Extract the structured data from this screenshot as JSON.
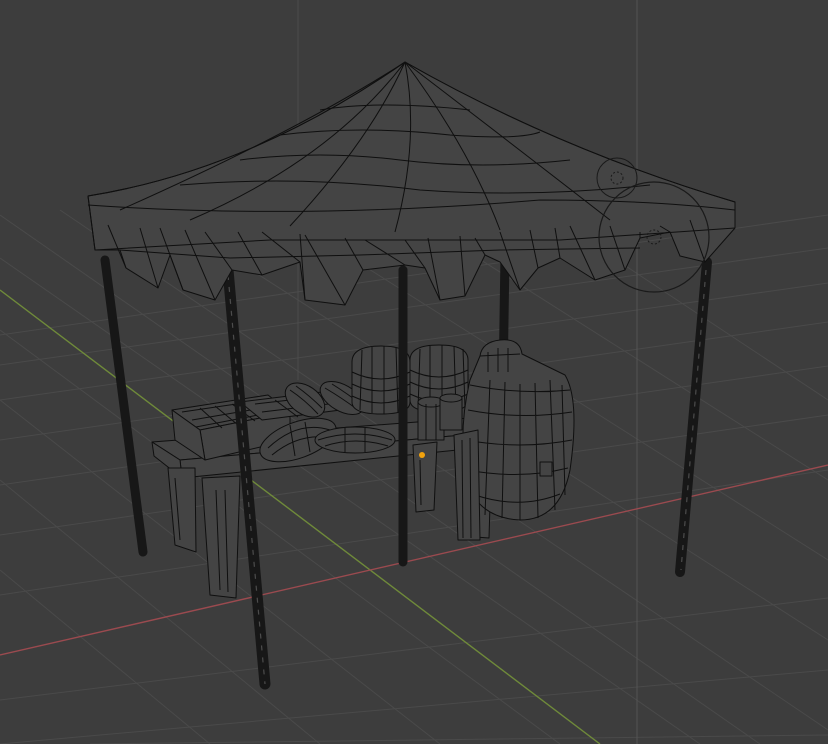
{
  "viewport": {
    "mode": "wireframe",
    "background": "#3d3d3d",
    "grid_color": "#4a4a4a",
    "x_axis_color": "#9b4a4f",
    "y_axis_color": "#6f8a3a",
    "wire_color": "#0f0f0f",
    "selected_origin_color": "#f2a20d"
  },
  "scene": {
    "objects": [
      "canopy",
      "support-poles",
      "market-table",
      "crates",
      "loaves",
      "barrels",
      "large-barrel",
      "mugs",
      "light-gizmo"
    ]
  }
}
